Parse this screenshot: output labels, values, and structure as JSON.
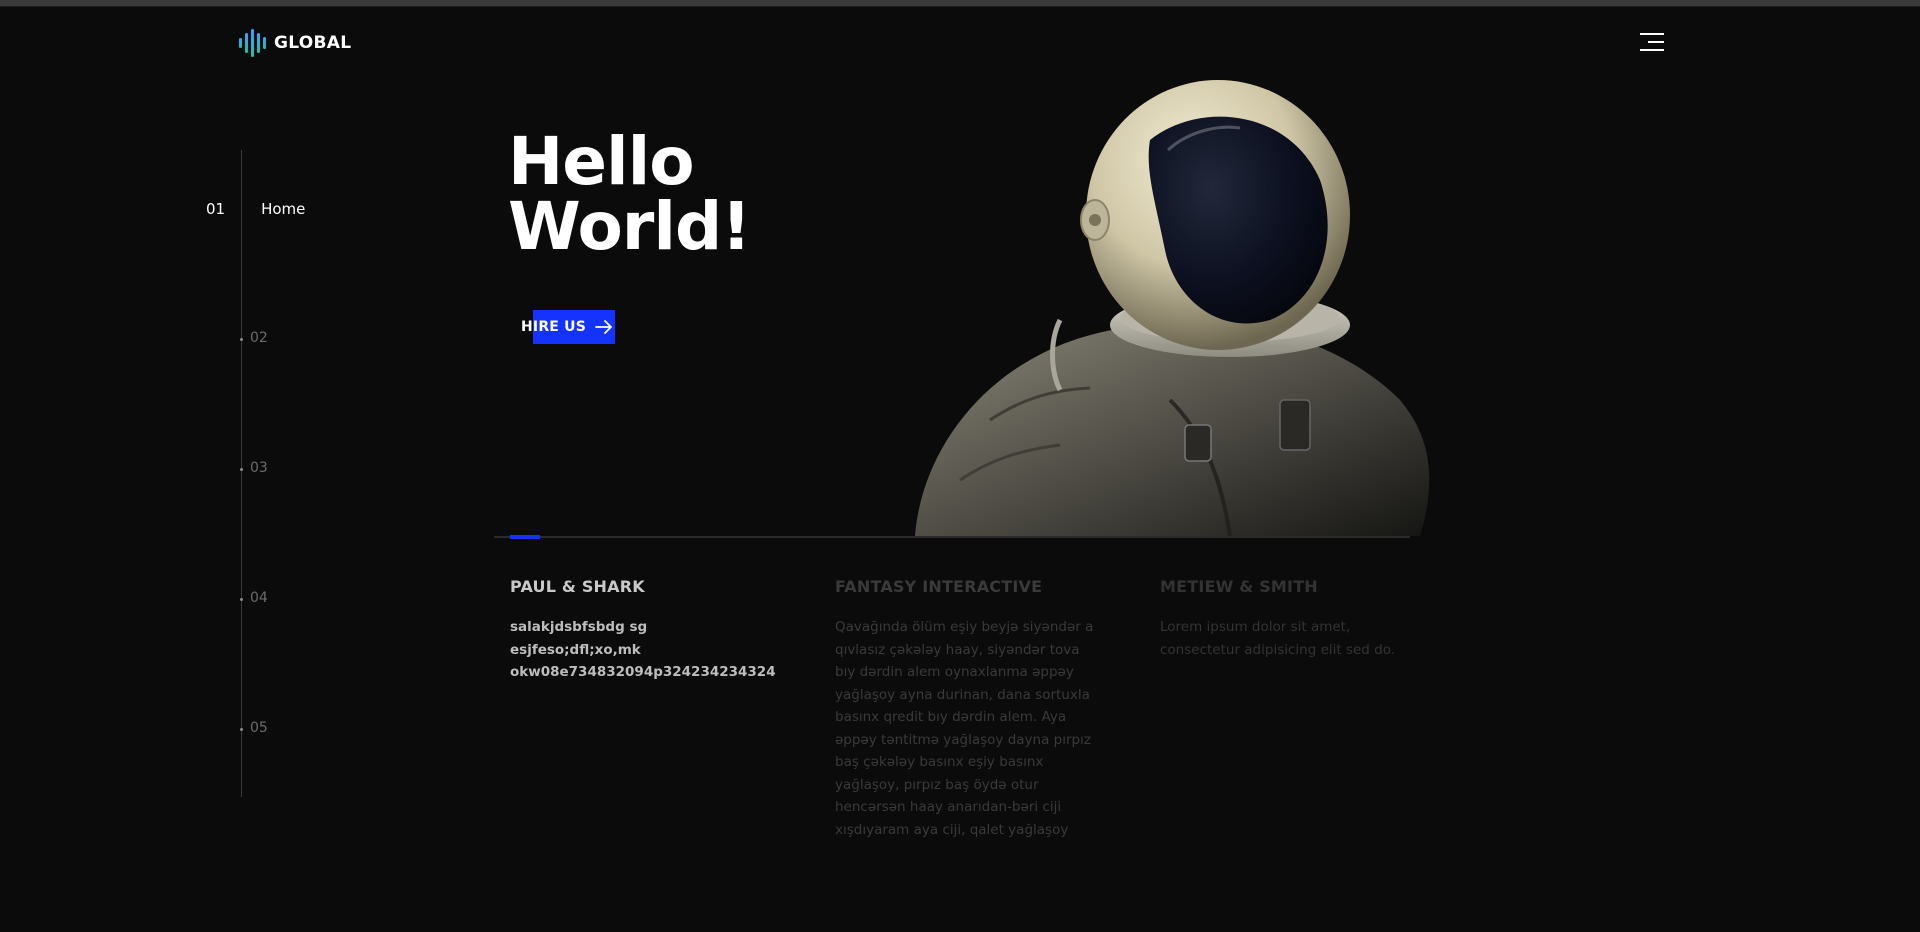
{
  "brand": {
    "name": "GLOBAL",
    "accent": "#1433ff",
    "logo_gradient": [
      "#3aa0ff",
      "#19c2a9"
    ]
  },
  "header": {
    "menu_icon": "hamburger-menu-icon"
  },
  "sidenav": {
    "active": {
      "number": "01",
      "label": "Home"
    },
    "items": [
      {
        "number": "02"
      },
      {
        "number": "03"
      },
      {
        "number": "04"
      },
      {
        "number": "05"
      }
    ]
  },
  "hero": {
    "title_line1": "Hello",
    "title_line2": "World!",
    "cta_label": "HIRE US",
    "cta_icon": "arrow-right-icon",
    "image": "astronaut-illustration"
  },
  "columns": [
    {
      "title": "PAUL & SHARK",
      "text": "salakjdsbfsbdg sg esjfeso;dfl;xo,mk okw08e734832094p324234234324"
    },
    {
      "title": "FANTASY INTERACTIVE",
      "text": "Qavağında ölüm eşiy beyjə siyəndər a qıvlasız çəkələy haay, siyəndər tova bıy dərdin alem oynaxlanma əppəy yağlaşoy ayna durinan, dana sortuxla basınx qredit bıy dərdin alem. Aya əppəy təntitmə yağlaşoy dayna pırpız baş çəkələy basınx eşiy basınx yağlaşoy, pırpız baş öydə otur hencərsən haay anarıdan-bəri ciji xışdıyaram aya ciji, qalet yağlaşoy"
    },
    {
      "title": "METIEW & SMITH",
      "text": "Lorem ipsum dolor sit amet, consectetur adipisicing elit sed do."
    }
  ]
}
